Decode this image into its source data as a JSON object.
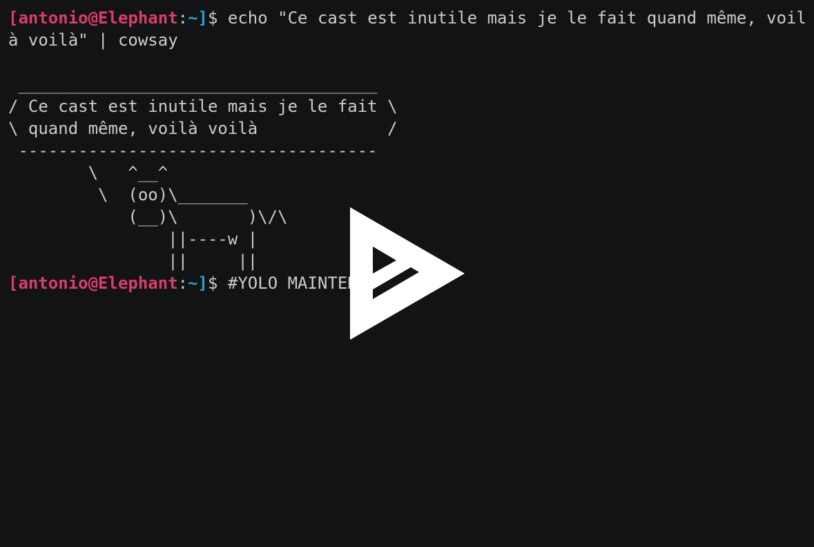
{
  "colors": {
    "background": "#121314",
    "foreground": "#cccccc",
    "prompt_user": "#dc3d6a",
    "prompt_path": "#26a3d1",
    "play_icon": "#ffffff"
  },
  "prompt": {
    "open_bracket": "[",
    "user_host": "antonio@Elephant",
    "colon": ":",
    "path": "~",
    "close_bracket": "]",
    "dollar": "$ "
  },
  "command1": {
    "line1": "echo \"Ce cast est inutile mais je le fait quand même, voil",
    "line2": "à voilà\" | cowsay"
  },
  "cowsay": [
    " ____________________________________",
    "/ Ce cast est inutile mais je le fait \\",
    "\\ quand même, voilà voilà             /",
    " ------------------------------------",
    "        \\   ^__^",
    "         \\  (oo)\\_______",
    "            (__)\\       )\\/\\",
    "                ||----w |",
    "                ||     ||"
  ],
  "command2": "#YOLO MAINTENANT",
  "overlay": {
    "icon": "asciinema-play-icon"
  }
}
